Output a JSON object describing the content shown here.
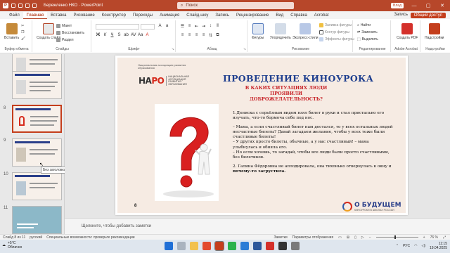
{
  "window": {
    "title": "Бережленко НКО  ·  PowerPoint",
    "search_placeholder": "Поиск",
    "user_badge": "Влад",
    "min": "—",
    "max": "▢",
    "close": "✕"
  },
  "tabs": [
    "Файл",
    "Главная",
    "Вставка",
    "Рисование",
    "Конструктор",
    "Переходы",
    "Анимация",
    "Слайд-шоу",
    "Запись",
    "Рецензирование",
    "Вид",
    "Справка",
    "Acrobat"
  ],
  "ribbon": {
    "record_label": "Запись",
    "share_label": "Общий доступ",
    "clipboard": {
      "paste": "Вставить",
      "label": "Буфер обмена"
    },
    "slides": {
      "new_slide": "Создать слайд",
      "layout": "Макет",
      "reset": "Восстановить",
      "section": "Раздел",
      "label": "Слайды"
    },
    "font": {
      "label": "Шрифт"
    },
    "paragraph": {
      "label": "Абзац"
    },
    "drawing": {
      "shapes": "Фигуры",
      "arrange": "Упорядочить",
      "quick_styles": "Экспресс-стили",
      "fill": "Заливка фигуры",
      "outline": "Контур фигуры",
      "effects": "Эффекты фигуры",
      "label": "Рисование"
    },
    "editing": {
      "find": "Найти",
      "replace": "Заменить",
      "select": "Выделить",
      "label": "Редактирование"
    },
    "acrobat": {
      "create_pdf": "Создать PDF",
      "label": "Adobe Acrobat"
    },
    "addins": {
      "addins": "Надстройки",
      "label": "Надстройки"
    }
  },
  "thumbnails": {
    "numbers": [
      "8",
      "9",
      "10",
      "11"
    ],
    "tooltip": "Без заголовка"
  },
  "slide": {
    "naro_small": "Национальная ассоциация развития образования",
    "naro_logo_a": "НА",
    "naro_logo_b": "РО",
    "naro_desc": "НАЦИОНАЛЬНАЯ АССОЦИАЦИЯ РАЗВИТИЯ ОБРАЗОВАНИЯ",
    "title": "ПРОВЕДЕНИЕ КИНОУРОКА",
    "subtitle": "В КАКИХ СИТУАЦИЯХ ЛЮДИ ПРОЯВИЛИ ДОБРОЖЕЛАТЕЛЬНОСТЬ?",
    "para1": "1.Дениска с серьёзным видом взял билет в руки и стал пристально его изучать, что-то бормоча себе под нос.",
    "para2": "– Мама, а если счастливый билет нам достался, то у всех остальных людей несчастные билеты? Давай загадаем желание, чтобы у всех тоже были счастливые билеты!",
    "para3": "– У других просто билеты, обычные, а у нас счастливый! – мама улыбнулась и обняла его.",
    "para4": "– Но если хочешь, то загадай, чтобы все люди были просто счастливыми, без билетиков.",
    "para5_normal": "2. Галина Фёдоровна не аплодировала, она тихонько отвернулась к окну и",
    "para5_bold": "почему-то загрустила.",
    "page_number": "8",
    "future_logo": "О БУДУЩЕМ",
    "future_sub": "КИНОУРОКИ В ШКОЛАХ РОССИИ"
  },
  "notes_placeholder": "Щелкните, чтобы добавить заметки",
  "status": {
    "slide_counter": "Слайд 8 из 11",
    "language": "русский",
    "accessibility": "Специальные возможности: проверьте рекомендации",
    "notes_btn": "Заметки",
    "display_btn": "Параметры отображения",
    "zoom": "76 %"
  },
  "taskbar": {
    "weather_temp": "+5°C",
    "weather_desc": "Облачно",
    "lang": "РУС",
    "time": "11:15",
    "date": "19.04.2025"
  },
  "colors": {
    "accent": "#b7472a",
    "slide_title": "#1f3f8f",
    "slide_subtitle": "#c8252a"
  }
}
